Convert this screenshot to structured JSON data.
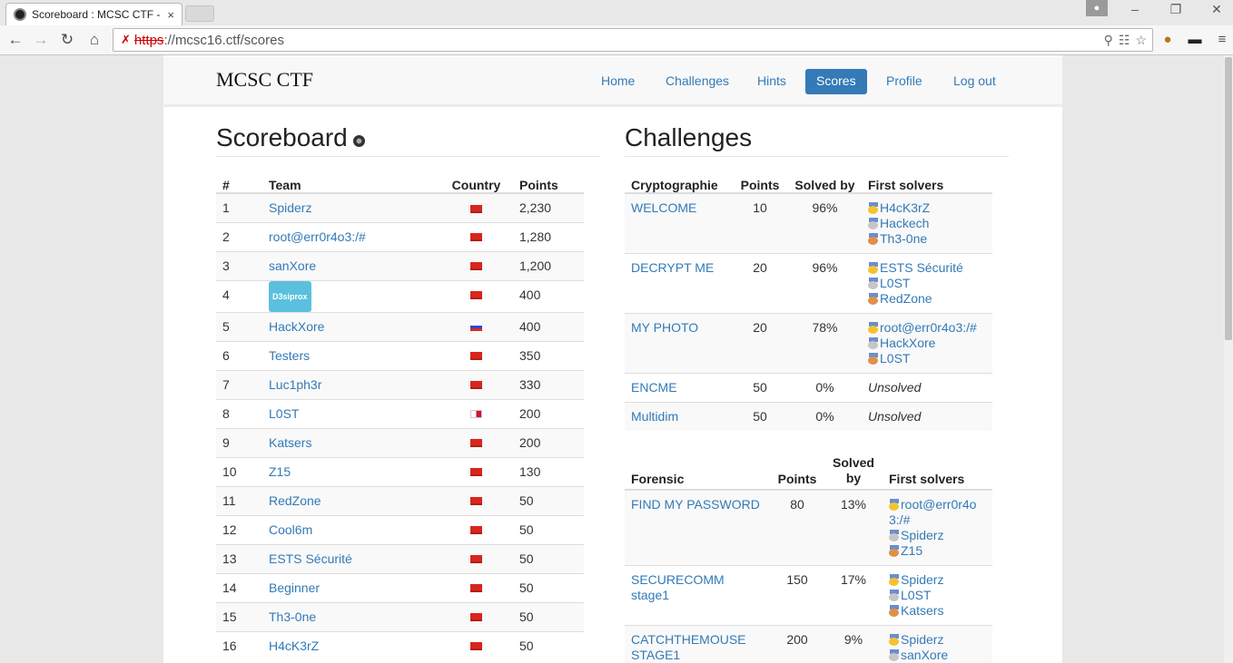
{
  "browser": {
    "tab_title": "Scoreboard : MCSC CTF -",
    "tab_close": "×",
    "url_scheme": "https",
    "url_rest": "://mcsc16.ctf/scores"
  },
  "navbar": {
    "brand": "MCSC CTF",
    "links": [
      "Home",
      "Challenges",
      "Hints",
      "Scores",
      "Profile",
      "Log out"
    ],
    "active": "Scores"
  },
  "scoreboard": {
    "title": "Scoreboard",
    "headers": [
      "#",
      "Team",
      "Country",
      "Points"
    ],
    "rows": [
      {
        "rank": "1",
        "team": "Spiderz",
        "flag": "red-flag",
        "points": "2,230"
      },
      {
        "rank": "2",
        "team": "root@err0r4o3:/#",
        "flag": "red-flag",
        "points": "1,280"
      },
      {
        "rank": "3",
        "team": "sanXore",
        "flag": "red-flag",
        "points": "1,200"
      },
      {
        "rank": "4",
        "team": "D3siprox",
        "flag": "red-flag",
        "points": "400",
        "badge": true
      },
      {
        "rank": "5",
        "team": "HackXore",
        "flag": "russia-flag",
        "points": "400"
      },
      {
        "rank": "6",
        "team": "Testers",
        "flag": "red-flag",
        "points": "350"
      },
      {
        "rank": "7",
        "team": "Luc1ph3r",
        "flag": "red-flag",
        "points": "330"
      },
      {
        "rank": "8",
        "team": "L0ST",
        "flag": "panama-flag",
        "points": "200"
      },
      {
        "rank": "9",
        "team": "Katsers",
        "flag": "red-flag",
        "points": "200"
      },
      {
        "rank": "10",
        "team": "Z15",
        "flag": "red-flag",
        "points": "130"
      },
      {
        "rank": "11",
        "team": "RedZone",
        "flag": "red-flag",
        "points": "50"
      },
      {
        "rank": "12",
        "team": "Cool6m",
        "flag": "red-flag",
        "points": "50"
      },
      {
        "rank": "13",
        "team": "ESTS Sécurité",
        "flag": "red-flag",
        "points": "50"
      },
      {
        "rank": "14",
        "team": "Beginner",
        "flag": "red-flag",
        "points": "50"
      },
      {
        "rank": "15",
        "team": "Th3-0ne",
        "flag": "red-flag",
        "points": "50"
      },
      {
        "rank": "16",
        "team": "H4cK3rZ",
        "flag": "red-flag",
        "points": "50"
      }
    ]
  },
  "challenges": {
    "title": "Challenges",
    "crypto": {
      "headers": [
        "Cryptographie",
        "Points",
        "Solved by",
        "First solvers"
      ],
      "rows": [
        {
          "name": "WELCOME",
          "points": "10",
          "solved": "96%",
          "solvers": [
            "H4cK3rZ",
            "Hackech",
            "Th3-0ne"
          ]
        },
        {
          "name": "DECRYPT ME",
          "points": "20",
          "solved": "96%",
          "solvers": [
            "ESTS Sécurité",
            "L0ST",
            "RedZone"
          ]
        },
        {
          "name": "MY PHOTO",
          "points": "20",
          "solved": "78%",
          "solvers": [
            "root@err0r4o3:/#",
            "HackXore",
            "L0ST"
          ]
        },
        {
          "name": "ENCME",
          "points": "50",
          "solved": "0%",
          "unsolved": "Unsolved"
        },
        {
          "name": "Multidim",
          "points": "50",
          "solved": "0%",
          "unsolved": "Unsolved"
        }
      ]
    },
    "forensic": {
      "headers": [
        "Forensic",
        "Points",
        "Solved by",
        "First solvers"
      ],
      "rows": [
        {
          "name": "FIND MY PASSWORD",
          "points": "80",
          "solved": "13%",
          "solvers": [
            "root@err0r4o3:/#",
            "Spiderz",
            "Z15"
          ]
        },
        {
          "name": "SECURECOMM stage1",
          "points": "150",
          "solved": "17%",
          "solvers": [
            "Spiderz",
            "L0ST",
            "Katsers"
          ]
        },
        {
          "name": "CATCHTHEMOUSE STAGE1",
          "points": "200",
          "solved": "9%",
          "solvers": [
            "Spiderz",
            "sanXore"
          ]
        }
      ]
    }
  }
}
